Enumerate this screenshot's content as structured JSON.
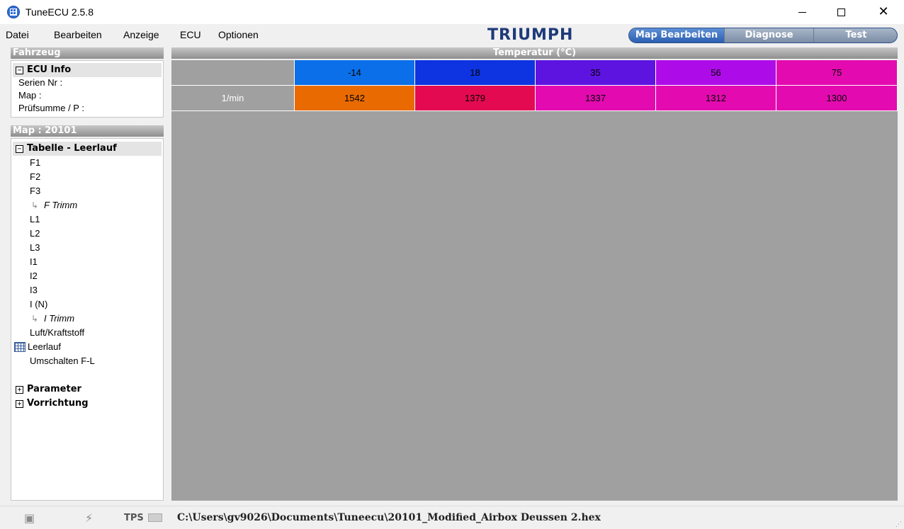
{
  "window": {
    "title": "TuneECU 2.5.8"
  },
  "menu": {
    "items": [
      "Datei",
      "Bearbeiten",
      "Anzeige",
      "ECU",
      "Optionen"
    ]
  },
  "logo": {
    "text": "TRIUMPH"
  },
  "tabs": {
    "items": [
      "Map Bearbeiten",
      "Diagnose",
      "Test"
    ],
    "active": "Map Bearbeiten"
  },
  "fahrzeug": {
    "header": "Fahrzeug",
    "ecu_info_title": "ECU Info",
    "fields": [
      "Serien Nr :",
      "Map :",
      "Prüfsumme / P :"
    ]
  },
  "map_panel": {
    "header": "Map : 20101",
    "group_title": "Tabelle - Leerlauf",
    "items": [
      "F1",
      "F2",
      "F3",
      "F Trimm",
      "L1",
      "L2",
      "L3",
      "I1",
      "I2",
      "I3",
      "I (N)",
      "I Trimm",
      "Luft/Kraftstoff",
      "Leerlauf",
      "Umschalten F-L"
    ],
    "selected": "Leerlauf",
    "extra_groups": [
      "Parameter",
      "Vorrichtung"
    ]
  },
  "table": {
    "header": "Temperatur (°C)",
    "columns": [
      "-14",
      "18",
      "35",
      "56",
      "75"
    ],
    "column_colors": [
      "#0a6fe8",
      "#0d34e0",
      "#5d14e0",
      "#ad0ce8",
      "#e30ab0"
    ],
    "row_label": "1/min",
    "values": [
      "1542",
      "1379",
      "1337",
      "1312",
      "1300"
    ],
    "value_colors": [
      "#e86a00",
      "#e30a52",
      "#e30ab0",
      "#e30ab0",
      "#e30ab0"
    ]
  },
  "status": {
    "tps_label": "TPS",
    "file_path": "C:\\Users\\gv9026\\Documents\\Tuneecu\\20101_Modified_Airbox Deussen 2.hex"
  }
}
